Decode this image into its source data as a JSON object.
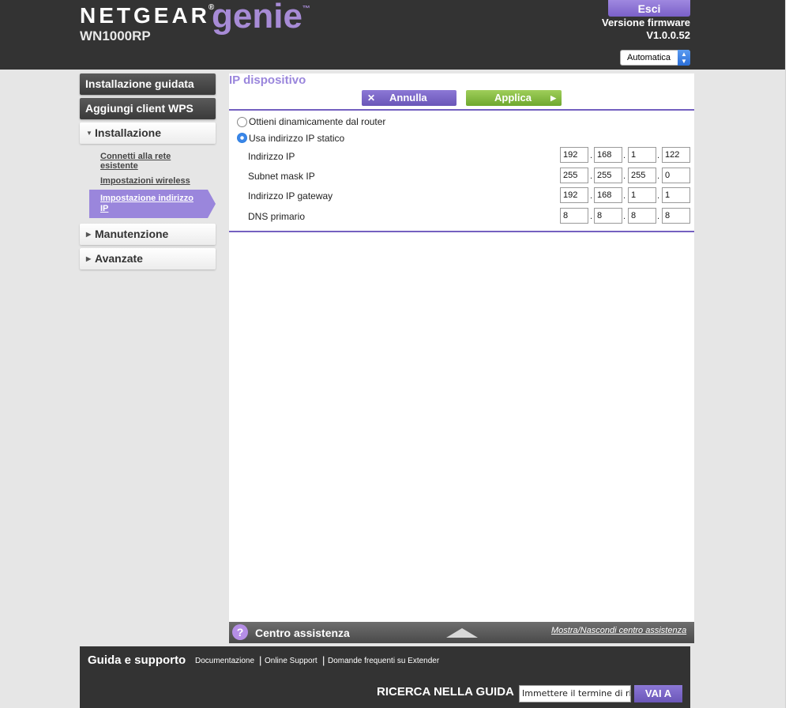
{
  "header": {
    "brand": "NETGEAR",
    "brand_mark": "®",
    "product": "genie",
    "product_mark": "™",
    "model": "WN1000RP",
    "logout_label": "Esci",
    "firmware_label": "Versione firmware",
    "firmware_version": "V1.0.0.52",
    "language_value": "Automatica"
  },
  "sidebar": {
    "wizard_label": "Installazione guidata",
    "wps_label": "Aggiungi client WPS",
    "setup_label": "Installazione",
    "setup_items": [
      {
        "label": "Connetti alla rete esistente"
      },
      {
        "label": "Impostazioni wireless"
      },
      {
        "label": "Impostazione indirizzo IP"
      }
    ],
    "maintenance_label": "Manutenzione",
    "advanced_label": "Avanzate"
  },
  "main": {
    "title": "IP dispositivo",
    "cancel_label": "Annulla",
    "apply_label": "Applica",
    "radio_dynamic_label": "Ottieni dinamicamente dal router",
    "radio_static_label": "Usa indirizzo IP statico",
    "selected_mode": "static",
    "fields": [
      {
        "label": "Indirizzo IP",
        "octets": [
          "192",
          "168",
          "1",
          "122"
        ]
      },
      {
        "label": "Subnet mask IP",
        "octets": [
          "255",
          "255",
          "255",
          "0"
        ]
      },
      {
        "label": "Indirizzo IP gateway",
        "octets": [
          "192",
          "168",
          "1",
          "1"
        ]
      },
      {
        "label": "DNS primario",
        "octets": [
          "8",
          "8",
          "8",
          "8"
        ]
      }
    ],
    "octet_separator": "."
  },
  "help": {
    "icon_text": "?",
    "title": "Centro assistenza",
    "toggle_label": "Mostra/Nascondi centro assistenza"
  },
  "footer": {
    "title": "Guida e supporto",
    "links": [
      "Documentazione",
      "Online Support",
      "Domande frequenti su Extender"
    ],
    "separator": "|",
    "search_label": "RICERCA NELLA GUIDA",
    "search_value": "Immettere il termine di ricerca",
    "go_label": "VAI A"
  },
  "colors": {
    "header_bg": "#333333",
    "accent_purple": "#9a86dc",
    "apply_green": "#7fb83e",
    "page_bg": "#e6e6e6"
  }
}
